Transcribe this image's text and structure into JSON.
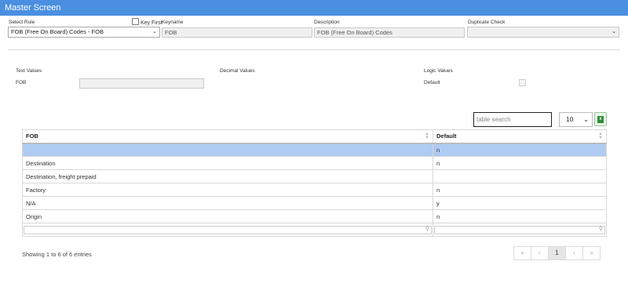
{
  "window": {
    "title": "Master Screen"
  },
  "form": {
    "select_rule_label": "Select Rule",
    "select_rule_value": "FOB (Free On Board) Codes - FOB",
    "key_first_label": "Key First",
    "keyname_label": "Keyname",
    "keyname_value": "FOB",
    "description_label": "Description",
    "description_value": "FOB (Free On Board) Codes",
    "duplicate_check_label": "Duplicate Check",
    "duplicate_check_value": ""
  },
  "values": {
    "text_values_label": "Text Values",
    "decimal_values_label": "Decimal Values",
    "logic_values_label": "Logic Values",
    "fob_label": "FOB",
    "fob_value": "",
    "default_label": "Default"
  },
  "table": {
    "search_placeholder": "table search",
    "page_length": "10",
    "columns": [
      "FOB",
      "Default"
    ],
    "rows": [
      {
        "fob": "",
        "default": "n"
      },
      {
        "fob": "Destination",
        "default": "n"
      },
      {
        "fob": "Destination, freight prepaid",
        "default": ""
      },
      {
        "fob": "Factory",
        "default": "n"
      },
      {
        "fob": "N/A",
        "default": "y"
      },
      {
        "fob": "Origin",
        "default": "n"
      }
    ],
    "info": "Showing 1 to 6 of 6 entries",
    "pager": {
      "first": "«",
      "prev": "‹",
      "current": "1",
      "next": "›",
      "last": "»"
    }
  },
  "colors": {
    "titlebar": "#4a8fe0",
    "selected_row": "#aecbf2"
  }
}
